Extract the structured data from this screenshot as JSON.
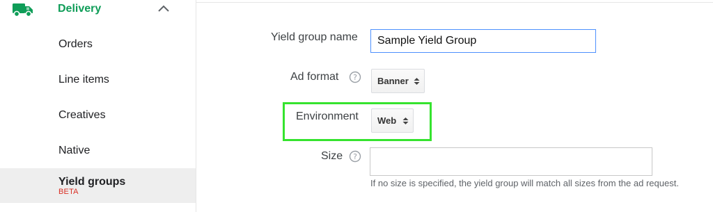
{
  "sidebar": {
    "section_title": "Delivery",
    "section_icon": "truck-icon",
    "items": [
      {
        "label": "Orders"
      },
      {
        "label": "Line items"
      },
      {
        "label": "Creatives"
      },
      {
        "label": "Native"
      },
      {
        "label": "Yield groups",
        "badge": "BETA",
        "active": true
      }
    ]
  },
  "form": {
    "yield_group_name": {
      "label": "Yield group name",
      "value": "Sample Yield Group"
    },
    "ad_format": {
      "label": "Ad format",
      "value": "Banner"
    },
    "environment": {
      "label": "Environment",
      "value": "Web"
    },
    "size": {
      "label": "Size",
      "value": "",
      "hint": "If no size is specified, the yield group will match all sizes from the ad request."
    }
  },
  "colors": {
    "brand_green": "#0f9d58",
    "highlight": "#35e32e",
    "focus_blue": "#4d90fe",
    "beta_red": "#d93025"
  }
}
